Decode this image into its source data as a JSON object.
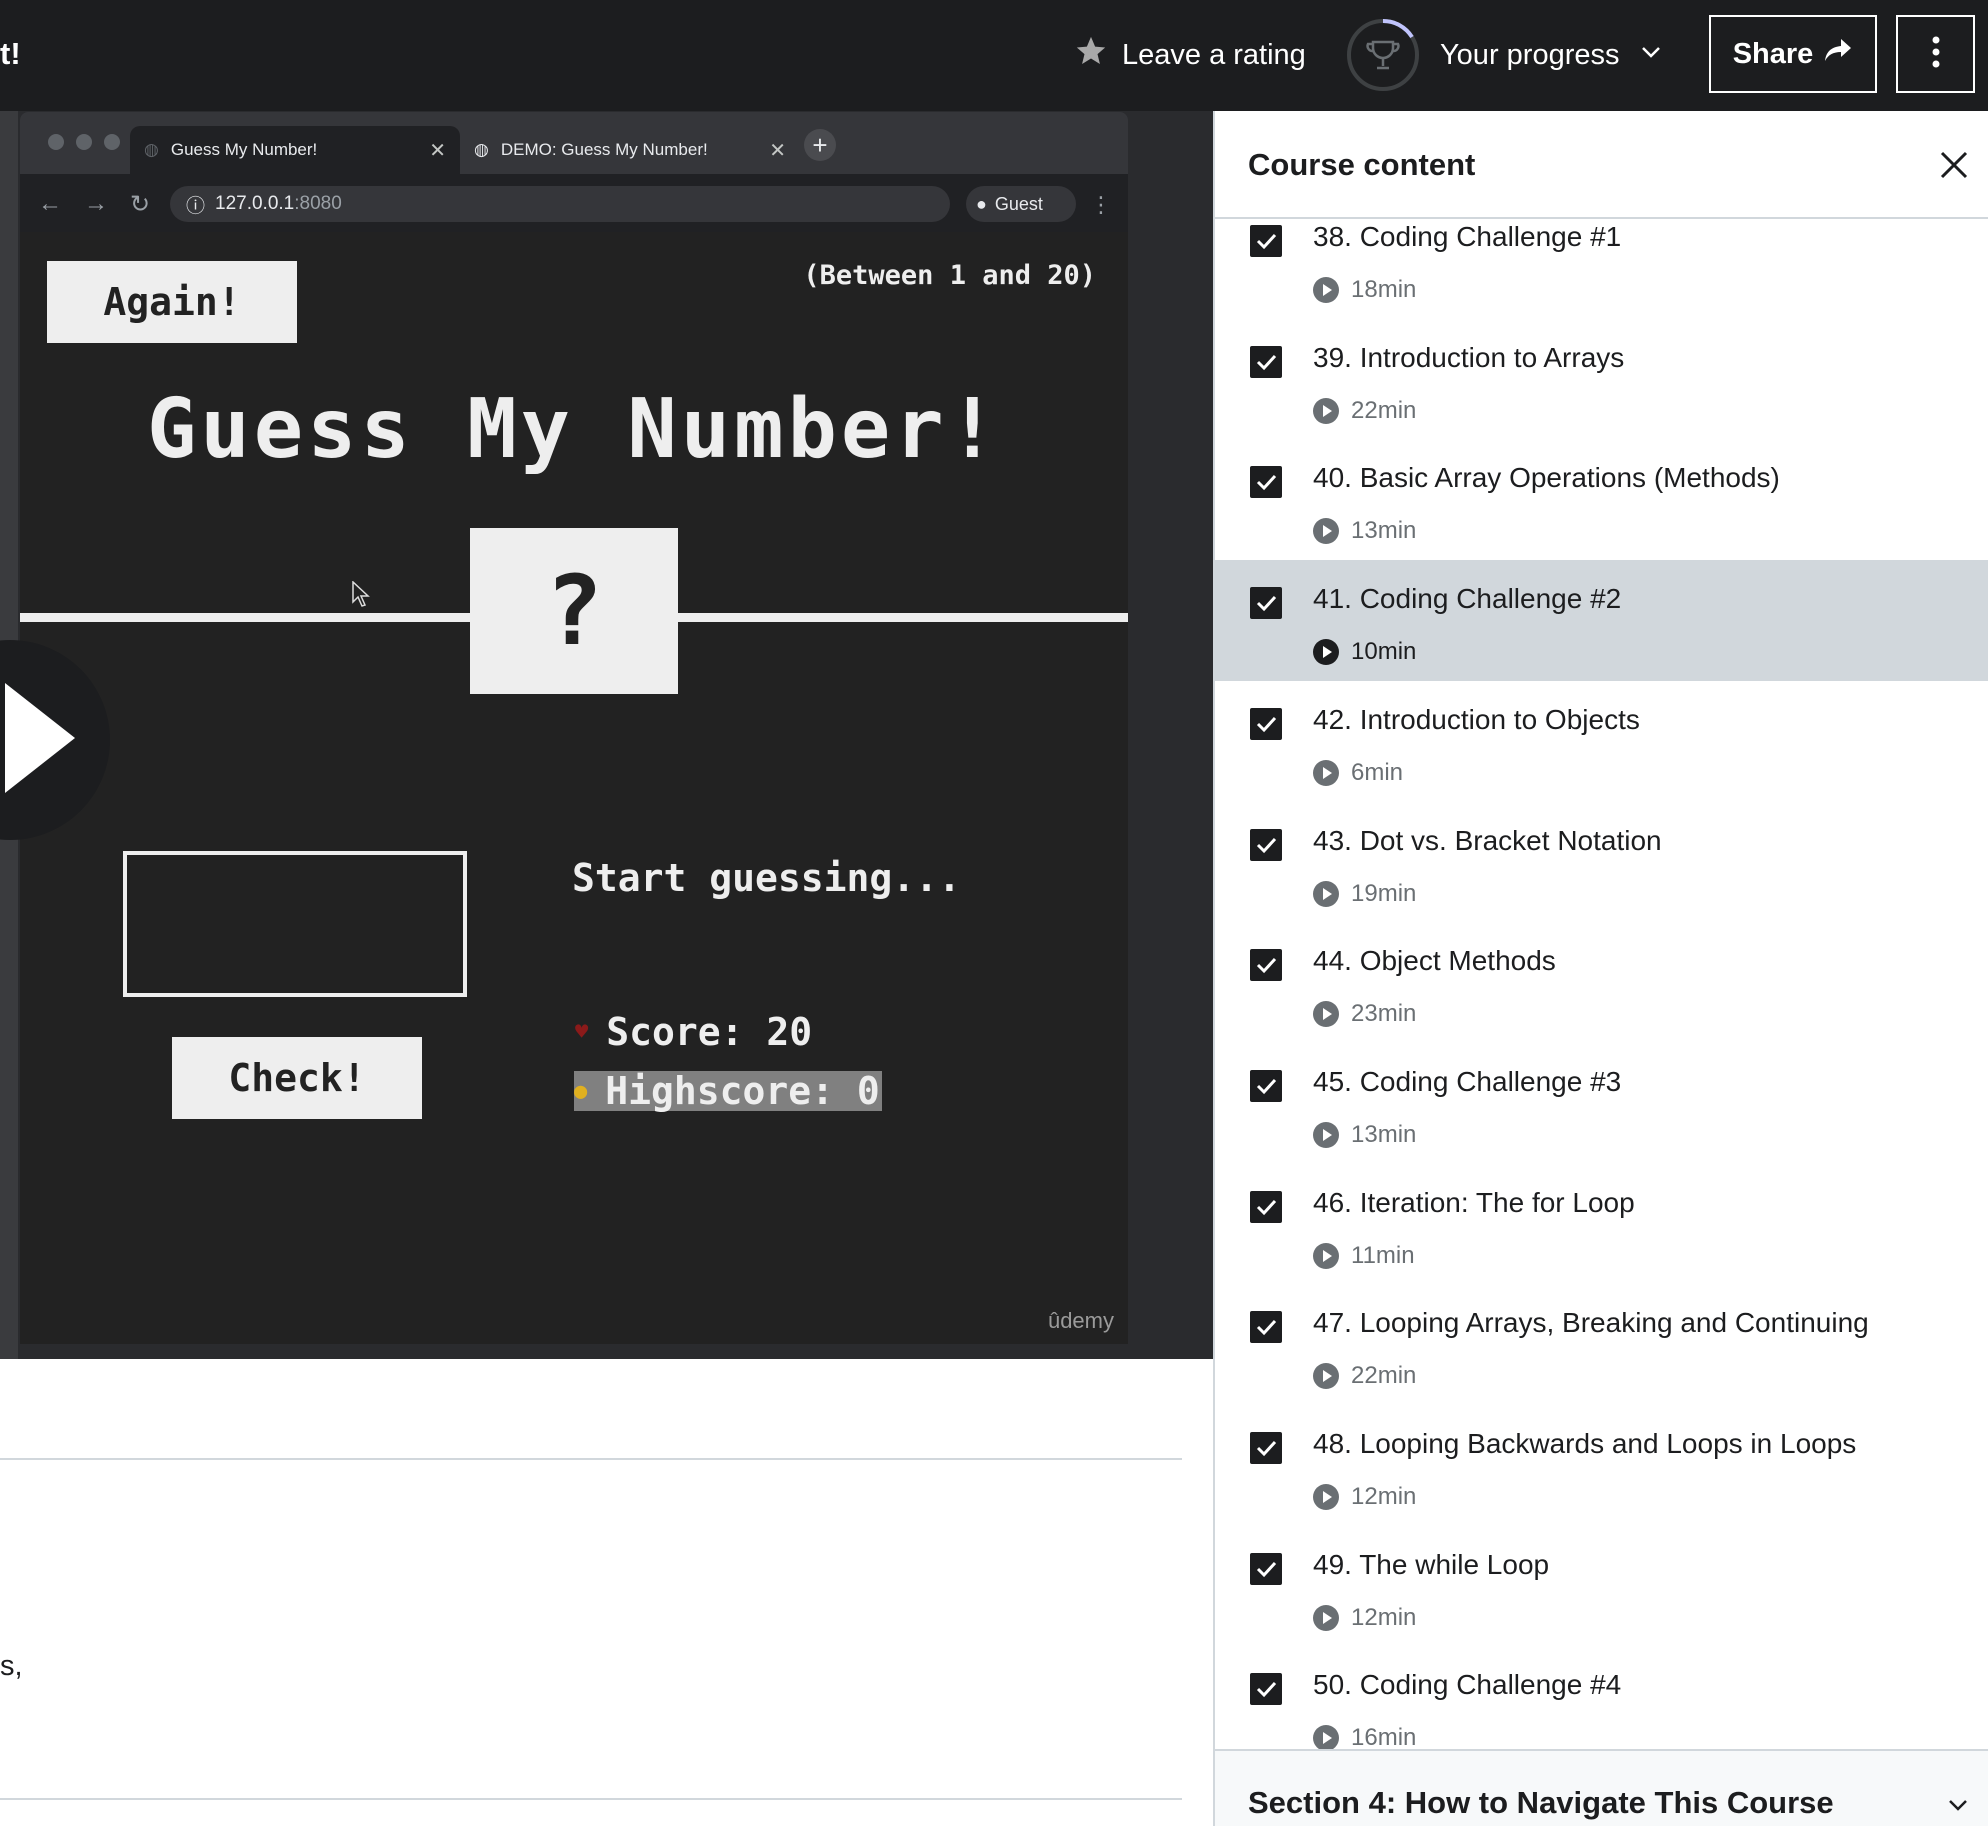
{
  "header": {
    "title_fragment": "t!",
    "leave_rating": "Leave a rating",
    "your_progress": "Your progress",
    "share": "Share"
  },
  "video": {
    "browser": {
      "tab1": "Guess My Number!",
      "tab2": "DEMO: Guess My Number!",
      "url_host": "127.0.0.1",
      "url_port": ":8080",
      "profile": "Guest"
    },
    "game": {
      "again": "Again!",
      "between": "(Between 1 and 20)",
      "title": "Guess My Number!",
      "number": "?",
      "message": "Start guessing...",
      "score_label": "Score: 20",
      "highscore_label": "Highscore: 0",
      "check": "Check!",
      "watermark": "ûdemy"
    }
  },
  "below": {
    "text_fragment": "s,"
  },
  "sidebar": {
    "title": "Course content",
    "items": [
      {
        "title": "38. Coding Challenge #1",
        "duration": "18min",
        "done": true,
        "active": false
      },
      {
        "title": "39. Introduction to Arrays",
        "duration": "22min",
        "done": true,
        "active": false
      },
      {
        "title": "40. Basic Array Operations (Methods)",
        "duration": "13min",
        "done": true,
        "active": false
      },
      {
        "title": "41. Coding Challenge #2",
        "duration": "10min",
        "done": true,
        "active": true
      },
      {
        "title": "42. Introduction to Objects",
        "duration": "6min",
        "done": true,
        "active": false
      },
      {
        "title": "43. Dot vs. Bracket Notation",
        "duration": "19min",
        "done": true,
        "active": false
      },
      {
        "title": "44. Object Methods",
        "duration": "23min",
        "done": true,
        "active": false
      },
      {
        "title": "45. Coding Challenge #3",
        "duration": "13min",
        "done": true,
        "active": false
      },
      {
        "title": "46. Iteration: The for Loop",
        "duration": "11min",
        "done": true,
        "active": false
      },
      {
        "title": "47. Looping Arrays, Breaking and Continuing",
        "duration": "22min",
        "done": true,
        "active": false
      },
      {
        "title": "48. Looping Backwards and Loops in Loops",
        "duration": "12min",
        "done": true,
        "active": false
      },
      {
        "title": "49. The while Loop",
        "duration": "12min",
        "done": true,
        "active": false
      },
      {
        "title": "50. Coding Challenge #4",
        "duration": "16min",
        "done": true,
        "active": false
      }
    ],
    "next_section": "Section 4: How to Navigate This Course"
  }
}
